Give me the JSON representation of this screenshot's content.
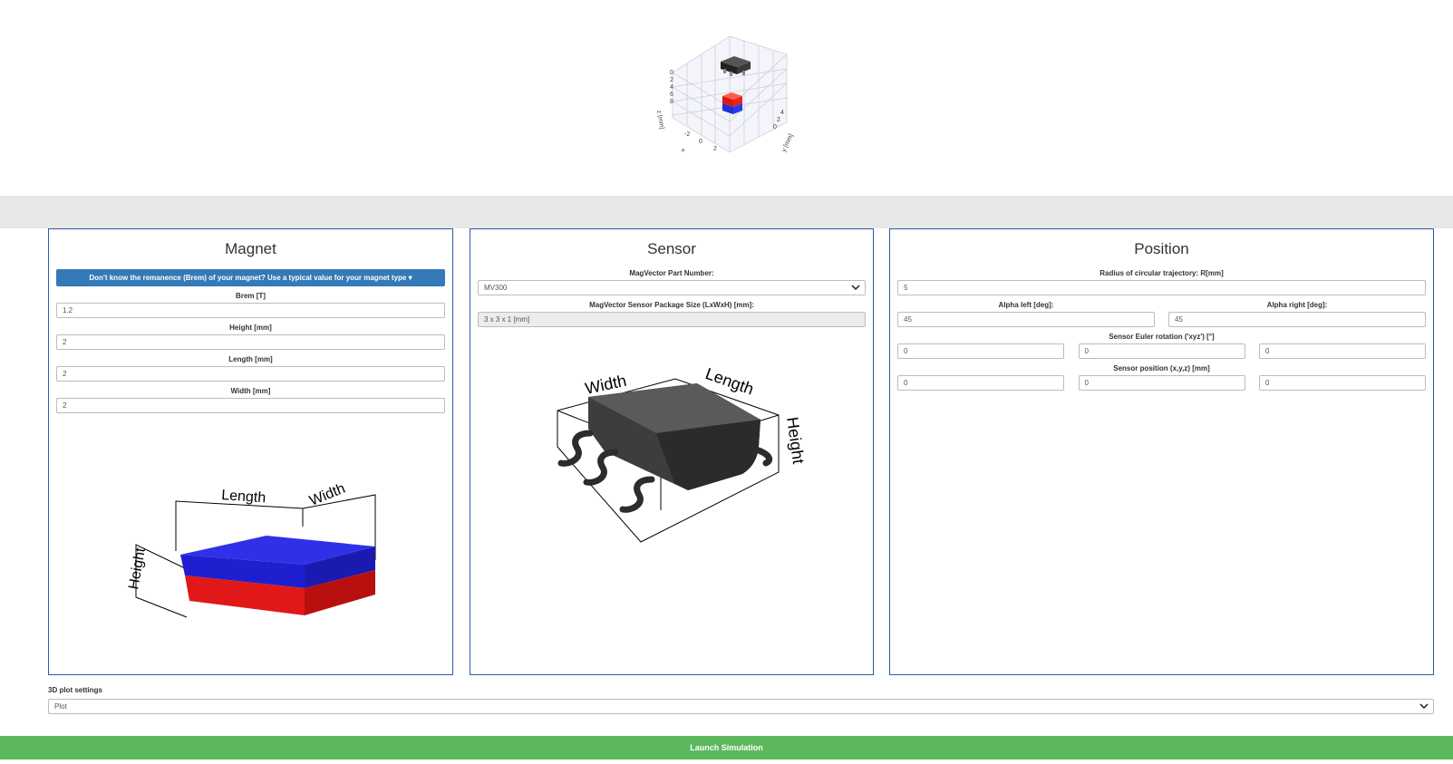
{
  "plot3d": {
    "xlabel": "x",
    "ylabel": "y [mm]",
    "zlabel": "z [mm]"
  },
  "magnet": {
    "title": "Magnet",
    "remanence_button": "Don't know the remanence (Brem) of your magnet? Use a typical value for your magnet type ▾",
    "fields": [
      {
        "label": "Brem [T]",
        "value": "1.2"
      },
      {
        "label": "Height [mm]",
        "value": "2"
      },
      {
        "label": "Length [mm]",
        "value": "2"
      },
      {
        "label": "Width [mm]",
        "value": "2"
      }
    ],
    "diagram": {
      "length": "Length",
      "width": "Width",
      "height": "Height"
    }
  },
  "sensor": {
    "title": "Sensor",
    "part_label": "MagVector Part Number:",
    "part_value": "MV300",
    "package_label": "MagVector Sensor Package Size (LxWxH) [mm]:",
    "package_value": "3 x 3 x 1 [mm]",
    "diagram": {
      "length": "Length",
      "width": "Width",
      "height": "Height"
    }
  },
  "position": {
    "title": "Position",
    "radius_label": "Radius of circular trajectory: R[mm]",
    "radius_value": "5",
    "alpha_left_label": "Alpha left [deg]:",
    "alpha_left_value": "45",
    "alpha_right_label": "Alpha right [deg]:",
    "alpha_right_value": "45",
    "euler_label": "Sensor Euler rotation ('xyz') [°]",
    "euler_values": [
      "0",
      "0",
      "0"
    ],
    "sensor_pos_label": "Sensor position (x,y,z) [mm]",
    "sensor_pos_values": [
      "0",
      "0",
      "0"
    ]
  },
  "plot_settings": {
    "label": "3D plot settings",
    "value": "Plot"
  },
  "launch_label": "Launch Simulation",
  "colors": {
    "panel_border": "#2a5ba6",
    "info_button": "#337ab7",
    "launch": "#5cb85c",
    "magnet_north": "#2b2bff",
    "magnet_south": "#dd1111"
  }
}
